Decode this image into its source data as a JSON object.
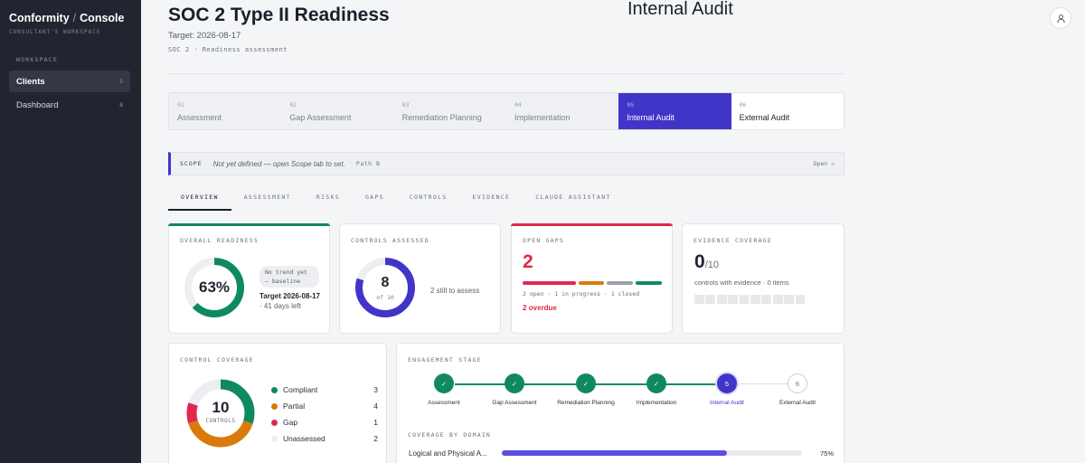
{
  "app": {
    "name": "Conformity",
    "section": "Console",
    "subtitle": "CONSULTANT'S WORKSPACE"
  },
  "sidebar": {
    "group_label": "WORKSPACE",
    "items": [
      {
        "label": "Clients",
        "count": "5",
        "active": true
      },
      {
        "label": "Dashboard",
        "count": "8",
        "active": false
      }
    ]
  },
  "header": {
    "title": "SOC 2 Type II Readiness",
    "target": "Target: 2026-08-17",
    "subline": "SOC 2 · Readiness assessment",
    "stage_heading": "Internal Audit"
  },
  "stepper": [
    {
      "num": "01",
      "label": "Assessment"
    },
    {
      "num": "02",
      "label": "Gap Assessment"
    },
    {
      "num": "03",
      "label": "Remediation Planning"
    },
    {
      "num": "04",
      "label": "Implementation"
    },
    {
      "num": "05",
      "label": "Internal Audit"
    },
    {
      "num": "06",
      "label": "External Audit"
    }
  ],
  "scope": {
    "tag": "SCOPE",
    "message": "Not yet defined — open Scope tab to set.",
    "path": "Path B",
    "open_label": "Open →"
  },
  "tabs": [
    "OVERVIEW",
    "ASSESSMENT",
    "RISKS",
    "GAPS",
    "CONTROLS",
    "EVIDENCE",
    "CLAUDE ASSISTANT"
  ],
  "cards": {
    "readiness": {
      "label": "OVERALL READINESS",
      "percent": 63,
      "percent_text": "63%",
      "trend": "No trend yet — baseline",
      "target_text": "Target 2026-08-17",
      "days_left": " · 41 days left",
      "accent": "#0f8a5f"
    },
    "controls_assessed": {
      "label": "CONTROLS ASSESSED",
      "assessed": 8,
      "total": 10,
      "value": "8",
      "of_text": "of 10",
      "remaining": "2 still to assess",
      "accent": "#4135c8"
    },
    "open_gaps": {
      "label": "OPEN GAPS",
      "value": "2",
      "summary": "2 open · 1 in progress · 1 closed",
      "overdue": "2 overdue",
      "accent": "#e0284e"
    },
    "evidence": {
      "label": "EVIDENCE COVERAGE",
      "value": "0",
      "total": "/10",
      "caption": "controls with evidence · 0 items"
    }
  },
  "coverage": {
    "label": "CONTROL COVERAGE",
    "total": "10",
    "unit": "CONTROLS",
    "items": [
      {
        "label": "Compliant",
        "value": 3,
        "value_text": "3",
        "color": "#0f8a5f"
      },
      {
        "label": "Partial",
        "value": 4,
        "value_text": "4",
        "color": "#d97a0c"
      },
      {
        "label": "Gap",
        "value": 1,
        "value_text": "1",
        "color": "#e0284e"
      },
      {
        "label": "Unassessed",
        "value": 2,
        "value_text": "2",
        "color": "#eceef1"
      }
    ]
  },
  "engagement": {
    "label": "ENGAGEMENT STAGE",
    "stages": [
      {
        "label": "Assessment",
        "mark": "✓",
        "state": "done"
      },
      {
        "label": "Gap Assessment",
        "mark": "✓",
        "state": "done"
      },
      {
        "label": "Remediation Planning",
        "mark": "✓",
        "state": "done"
      },
      {
        "label": "Implementation",
        "mark": "✓",
        "state": "done"
      },
      {
        "label": "Internal Audit",
        "mark": "5",
        "state": "current"
      },
      {
        "label": "External Audit",
        "mark": "6",
        "state": "todo"
      }
    ],
    "domain_label": "COVERAGE BY DOMAIN",
    "domains": [
      {
        "name": "Logical and Physical A...",
        "percent": 75,
        "percent_text": "75%"
      }
    ]
  }
}
